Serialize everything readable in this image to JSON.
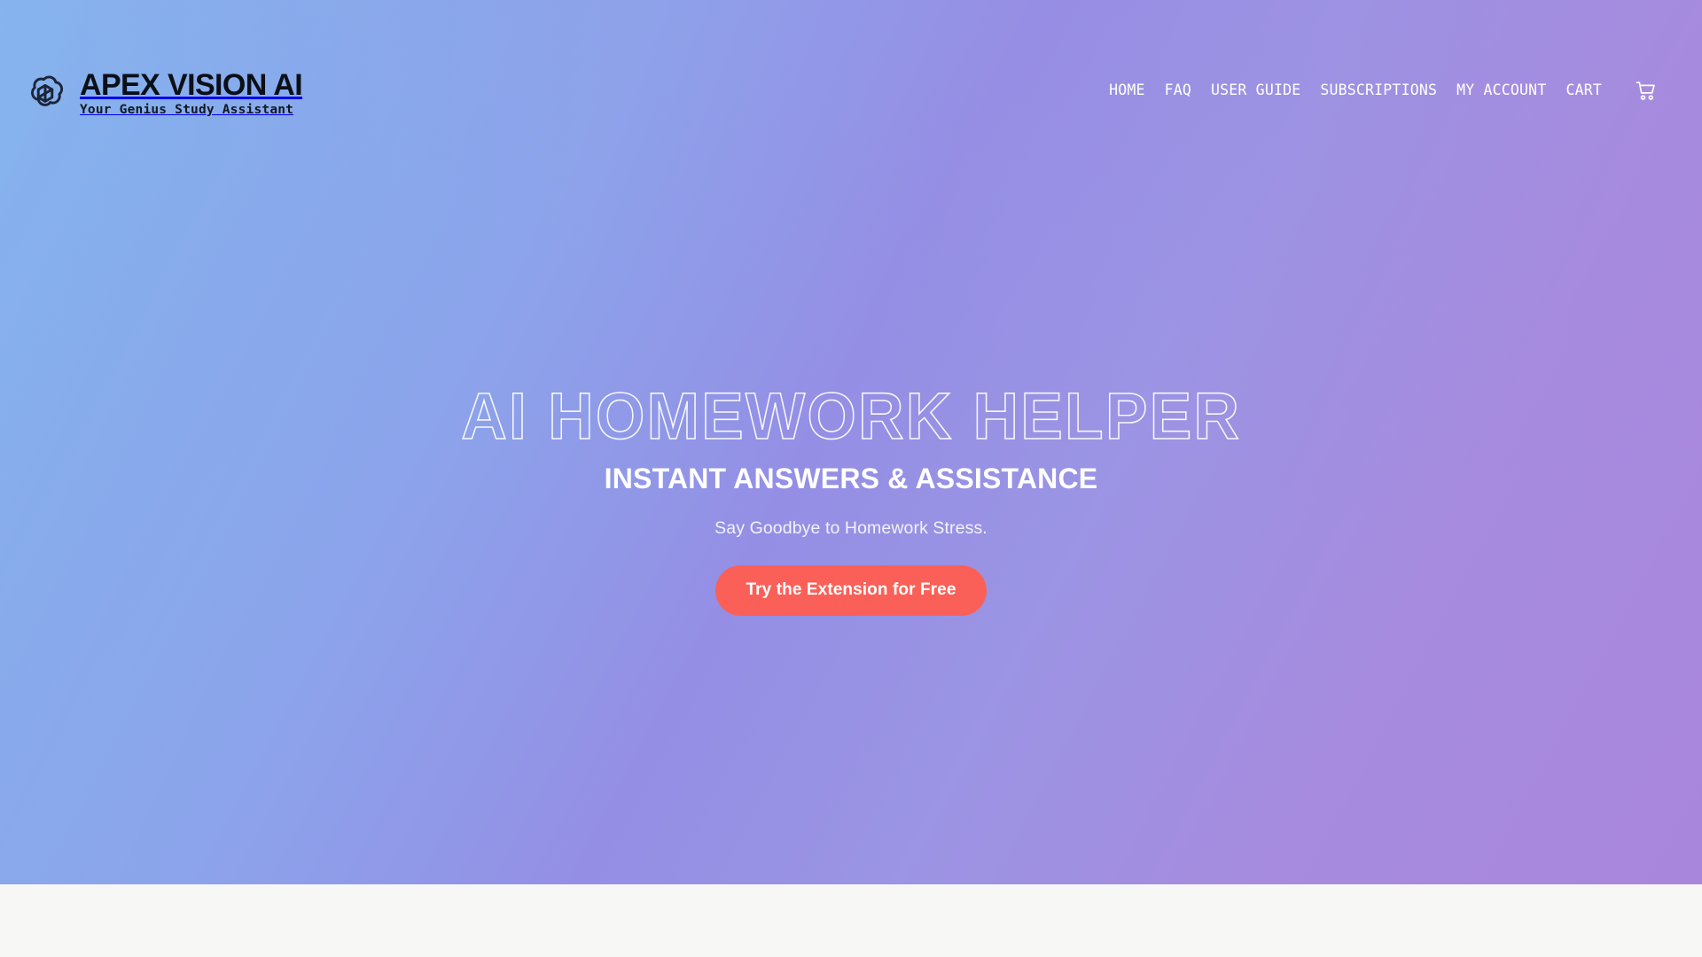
{
  "header": {
    "brand": {
      "logo_icon": "openai-knot-logo-icon",
      "logo_color": "#1C2438",
      "title": "APEX VISION AI",
      "tagline": "Your Genius Study Assistant"
    },
    "nav": {
      "items": [
        {
          "label": "HOME"
        },
        {
          "label": "FAQ"
        },
        {
          "label": "USER GUIDE"
        },
        {
          "label": "SUBSCRIPTIONS"
        },
        {
          "label": "MY ACCOUNT"
        },
        {
          "label": "CART"
        }
      ],
      "cart_icon": "shopping-cart-icon"
    }
  },
  "hero": {
    "headline": "AI HOMEWORK HELPER",
    "subheadline": "INSTANT ANSWERS & ASSISTANCE",
    "kicker": "Say Goodbye to Homework Stress.",
    "cta_label": "Try the Extension for Free"
  },
  "colors": {
    "gradient_bottom_left": "#7FB0EC",
    "gradient_top_left": "#8CA4EB",
    "gradient_bottom_right": "#9B94E4",
    "gradient_top_right": "#A886DC",
    "cta_background": "#FA6058",
    "nav_text": "#FFFFFF",
    "brand_text": "#0B0F17",
    "section_background": "#F7F7F6"
  }
}
